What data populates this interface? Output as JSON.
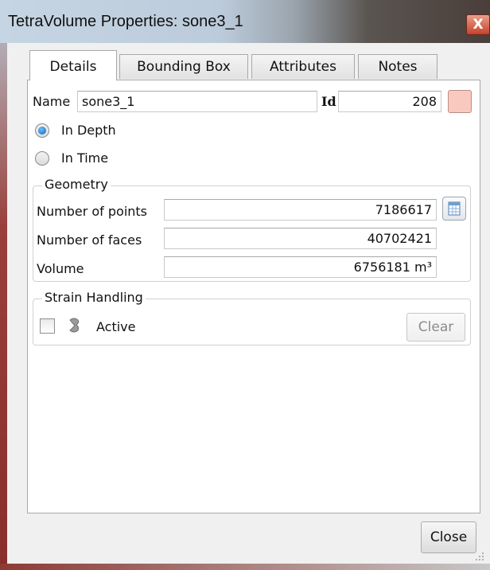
{
  "window": {
    "title": "TetraVolume Properties: sone3_1",
    "close_glyph": "X"
  },
  "tabs": [
    {
      "label": "Details",
      "active": true
    },
    {
      "label": "Bounding Box",
      "active": false
    },
    {
      "label": "Attributes",
      "active": false
    },
    {
      "label": "Notes",
      "active": false
    }
  ],
  "details": {
    "name_label": "Name",
    "name_value": "sone3_1",
    "id_label": "Id",
    "id_value": "208",
    "color_swatch": "#f9c9c0",
    "domain_options": [
      {
        "label": "In Depth",
        "checked": true
      },
      {
        "label": "In Time",
        "checked": false
      }
    ]
  },
  "geometry": {
    "title": "Geometry",
    "points_label": "Number of points",
    "points_value": "7186617",
    "faces_label": "Number of faces",
    "faces_value": "40702421",
    "volume_label": "Volume",
    "volume_value": "6756181 m³",
    "calculator_icon": "calculator-icon"
  },
  "strain": {
    "title": "Strain Handling",
    "active_label": "Active",
    "active_checked": false,
    "strain_icon": "strain-icon",
    "clear_label": "Clear",
    "clear_enabled": false
  },
  "footer": {
    "close_label": "Close"
  },
  "colors": {
    "accent": "#0d63b5",
    "window_frame": "#8a2e29"
  }
}
